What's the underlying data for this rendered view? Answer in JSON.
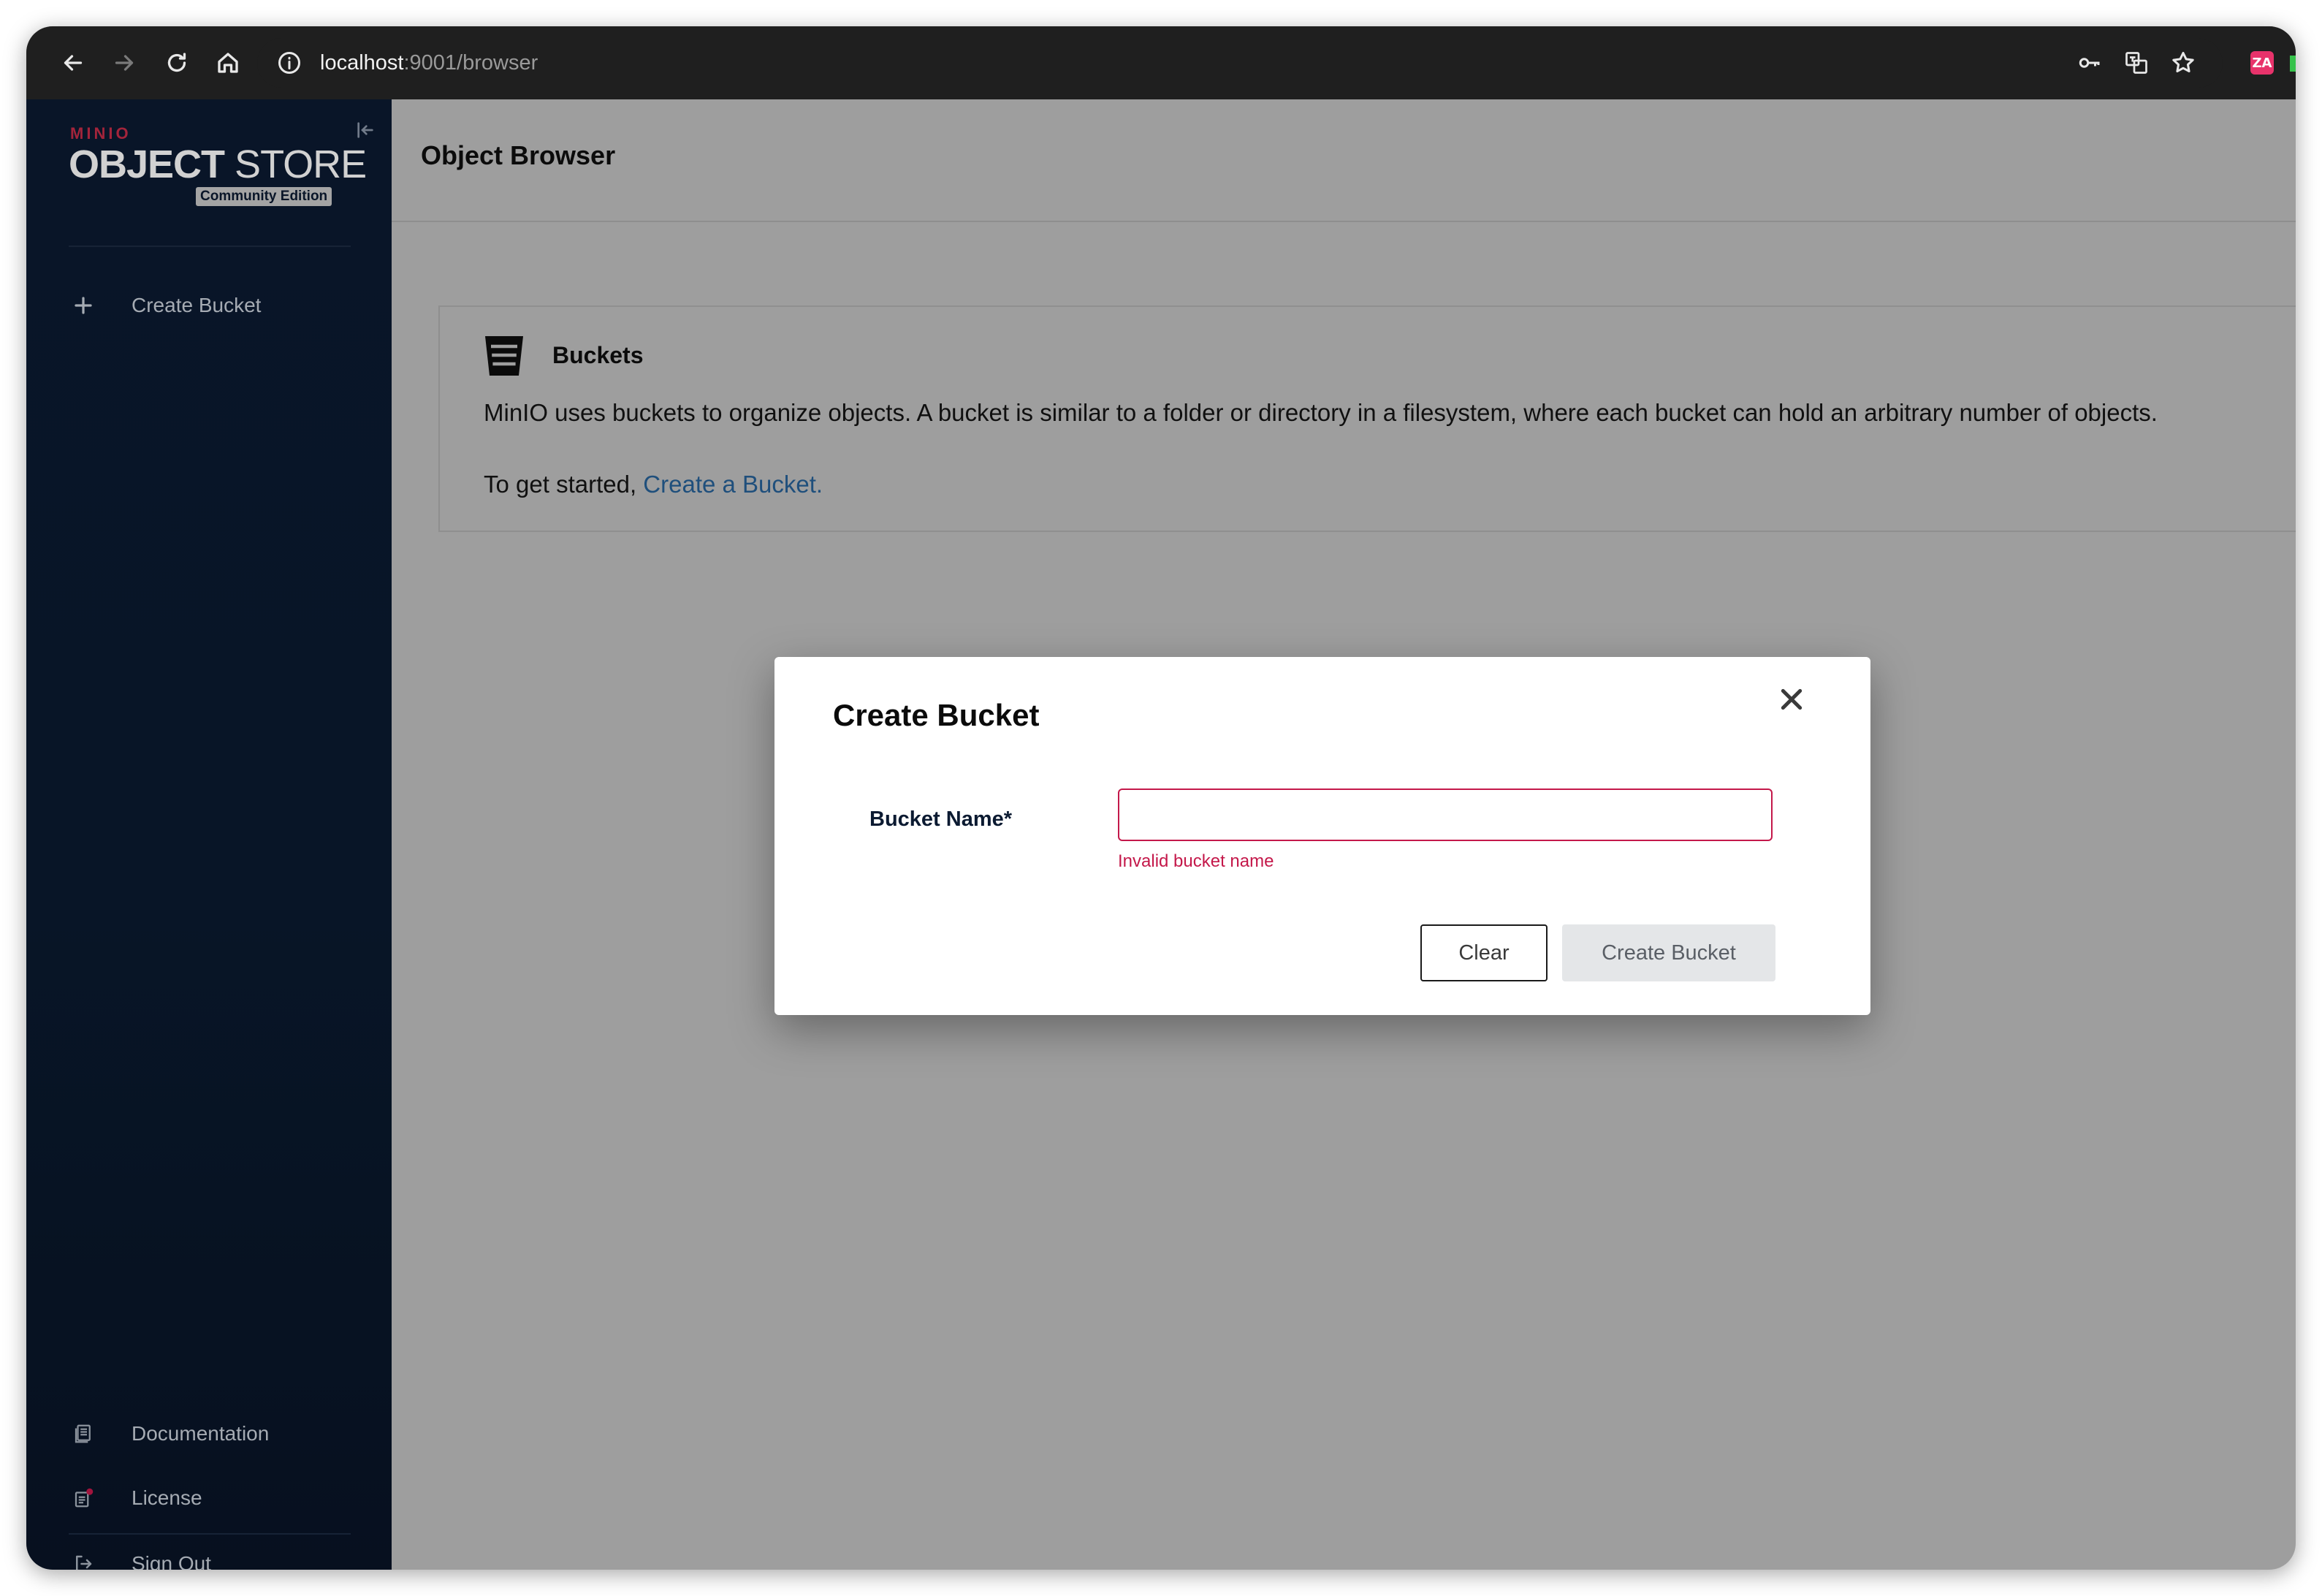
{
  "browser": {
    "url_host": "localhost",
    "url_path": ":9001/browser",
    "extension_label": "ZA"
  },
  "sidebar": {
    "brand_minio": "MINIO",
    "brand_object": "OBJECT",
    "brand_store": " STORE",
    "brand_edition": "Community Edition",
    "items": [
      {
        "label": "Create Bucket",
        "icon": "plus-icon"
      }
    ],
    "footer_items": [
      {
        "label": "Documentation",
        "icon": "document-icon"
      },
      {
        "label": "License",
        "icon": "license-icon"
      },
      {
        "label": "Sign Out",
        "icon": "sign-out-icon"
      }
    ]
  },
  "main": {
    "title": "Object Browser",
    "panel": {
      "title": "Buckets",
      "description": "MinIO uses buckets to organize objects. A bucket is similar to a folder or directory in a filesystem, where each bucket can hold an arbitrary number of objects.",
      "start_prefix": "To get started, ",
      "start_link": "Create a Bucket."
    }
  },
  "modal": {
    "title": "Create Bucket",
    "field_label": "Bucket Name*",
    "field_value": "",
    "field_error": "Invalid bucket name",
    "clear_label": "Clear",
    "create_label": "Create Bucket"
  },
  "colors": {
    "sidebar_bg": "#0b1a31",
    "accent_error": "#c4184a",
    "brand_red": "#c72c48",
    "link": "#1f4f7c"
  }
}
